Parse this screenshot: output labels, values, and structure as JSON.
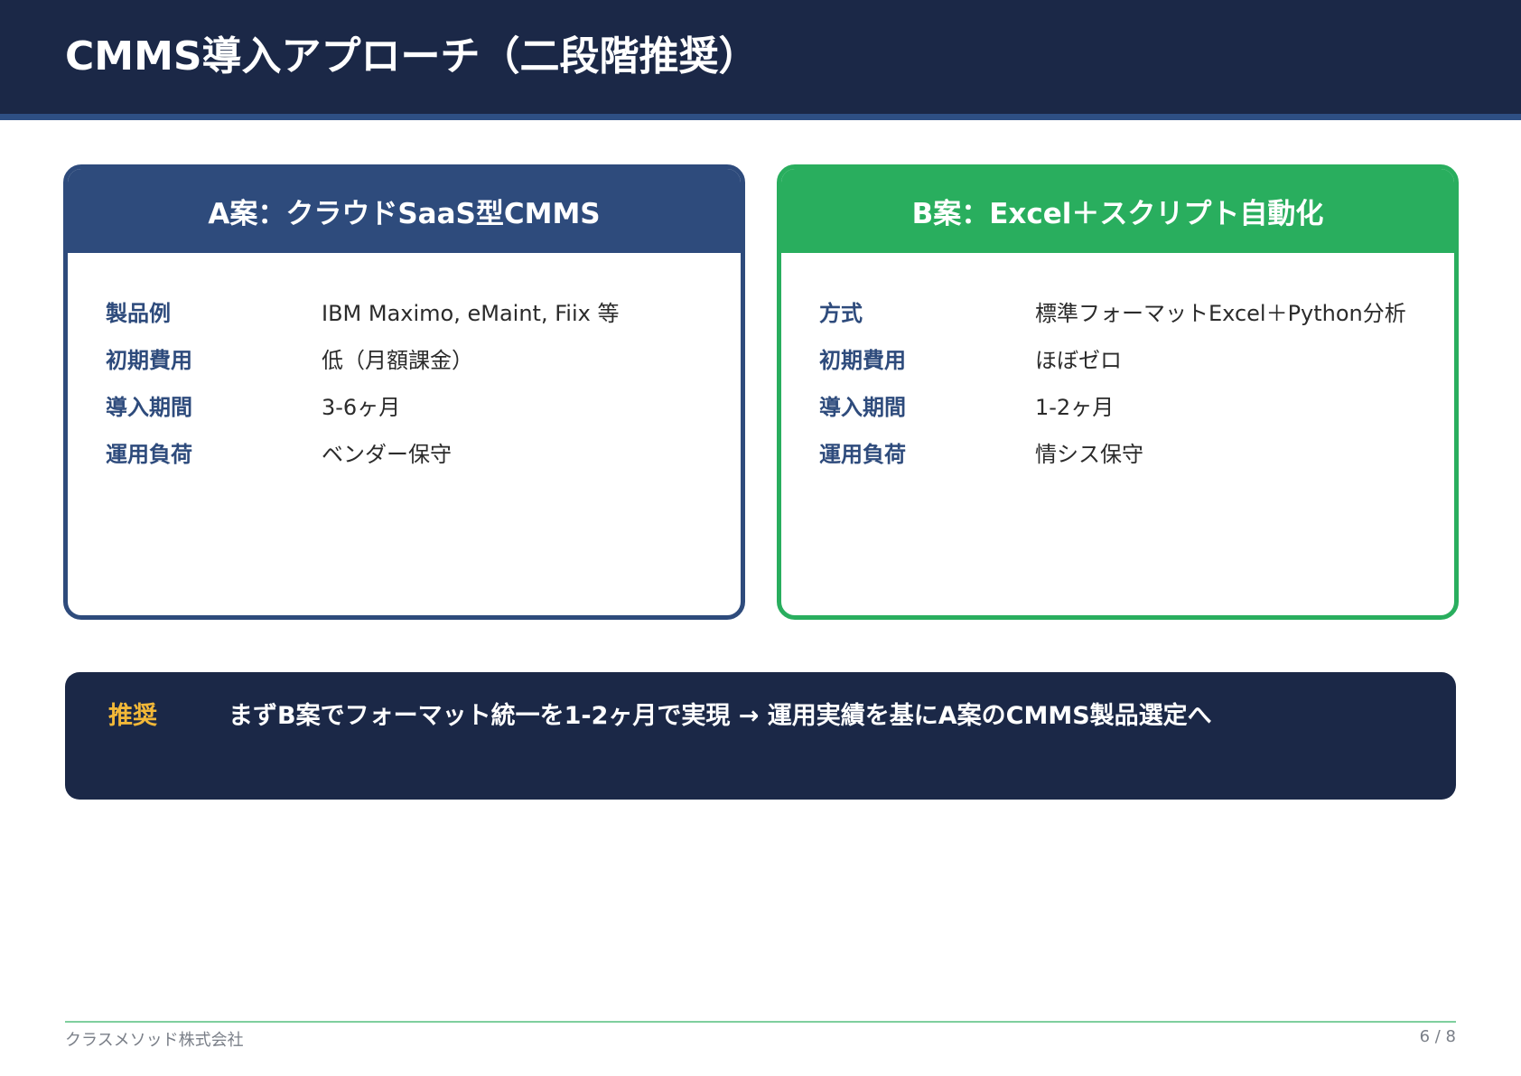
{
  "slide": {
    "title": "CMMS導入アプローチ（二段階推奨）"
  },
  "option_a": {
    "title": "A案：クラウドSaaS型CMMS",
    "rows": [
      {
        "label": "製品例",
        "value": "IBM Maximo, eMaint, Fiix 等"
      },
      {
        "label": "初期費用",
        "value": "低（月額課金）"
      },
      {
        "label": "導入期間",
        "value": "3-6ヶ月"
      },
      {
        "label": "運用負荷",
        "value": "ベンダー保守"
      }
    ]
  },
  "option_b": {
    "title": "B案：Excel＋スクリプト自動化",
    "rows": [
      {
        "label": "方式",
        "value": "標準フォーマットExcel＋Python分析"
      },
      {
        "label": "初期費用",
        "value": "ほぼゼロ"
      },
      {
        "label": "導入期間",
        "value": "1-2ヶ月"
      },
      {
        "label": "運用負荷",
        "value": "情シス保守"
      }
    ]
  },
  "recommendation": {
    "label": "推奨",
    "text": "まずB案でフォーマット統一を1-2ヶ月で実現 → 運用実績を基にA案のCMMS製品選定へ"
  },
  "footer": {
    "company": "クラスメソッド株式会社",
    "page": "6 / 8"
  },
  "colors": {
    "header_navy": "#1b2847",
    "option_a_blue": "#2e4b7c",
    "option_b_green": "#29ae5e",
    "recommend_yellow": "#f2b838"
  }
}
